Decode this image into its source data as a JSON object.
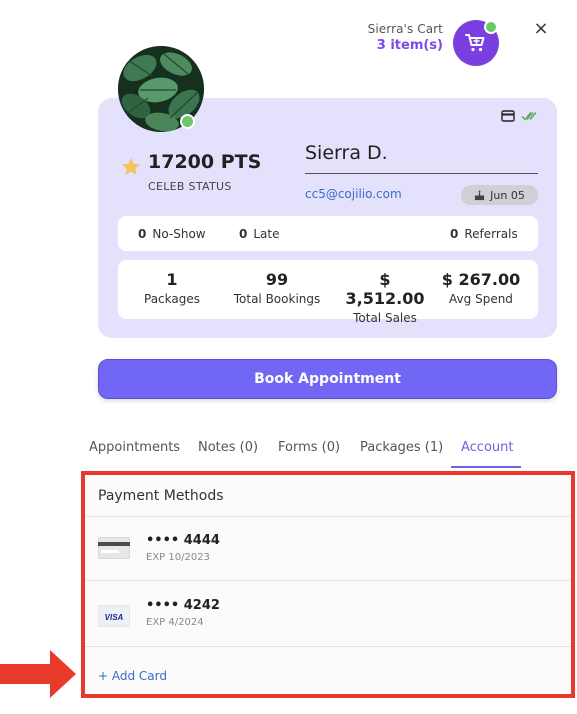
{
  "cart": {
    "name": "Sierra's Cart",
    "count": "3 item(s)"
  },
  "close_label": "×",
  "profile": {
    "points": "17200 PTS",
    "status": "CELEB STATUS",
    "name": "Sierra D.",
    "email": "cc5@cojilio.com",
    "birthday": "Jun 05"
  },
  "counters": {
    "no_show_value": "0",
    "no_show_label": "No-Show",
    "late_value": "0",
    "late_label": "Late",
    "referrals_value": "0",
    "referrals_label": "Referrals"
  },
  "stats": [
    {
      "value": "1",
      "label": "Packages"
    },
    {
      "value": "99",
      "label": "Total Bookings"
    },
    {
      "value": "$ 3,512.00",
      "label": "Total Sales"
    },
    {
      "value": "$ 267.00",
      "label": "Avg Spend"
    }
  ],
  "book_button": "Book Appointment",
  "tabs": [
    {
      "label": "Appointments",
      "active": false
    },
    {
      "label": "Notes (0)",
      "active": false
    },
    {
      "label": "Forms (0)",
      "active": false
    },
    {
      "label": "Packages (1)",
      "active": false
    },
    {
      "label": "Account",
      "active": true
    }
  ],
  "payment": {
    "title": "Payment Methods",
    "cards": [
      {
        "number": "•••• 4444",
        "expiry": "EXP 10/2023",
        "brand": "generic"
      },
      {
        "number": "•••• 4242",
        "expiry": "EXP 4/2024",
        "brand": "VISA"
      }
    ],
    "add_label": "+ Add Card"
  },
  "colors": {
    "accent": "#7266f5",
    "card_bg": "#e3e1fb",
    "highlight": "#e83a2a",
    "online": "#6cc66c",
    "cart": "#7b3fe0"
  },
  "icons": [
    "cart-icon",
    "close-icon",
    "credit-card-icon",
    "double-check-icon",
    "star-icon",
    "cake-icon",
    "arrow-right-icon"
  ]
}
